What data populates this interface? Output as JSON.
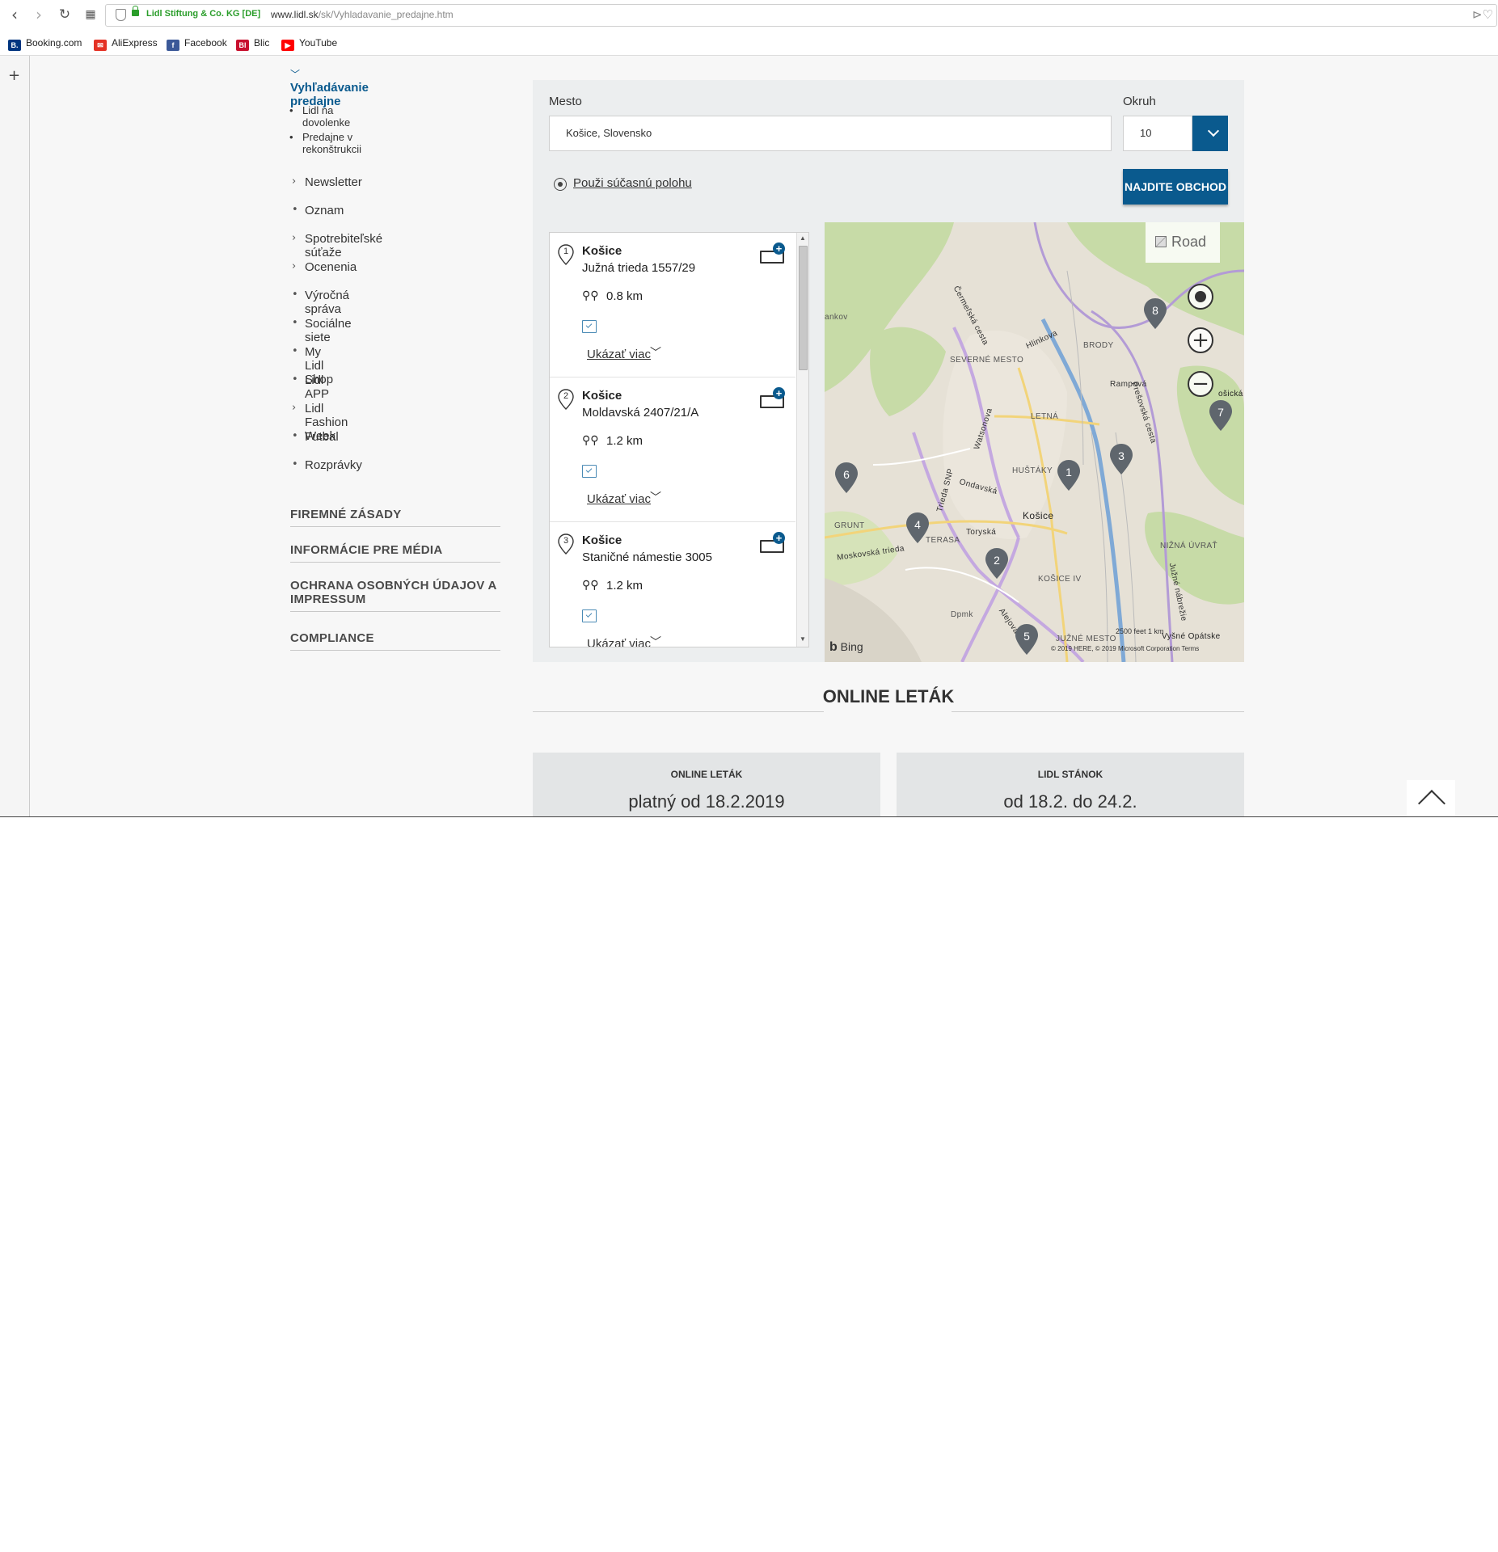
{
  "browser": {
    "org_label": "Lidl Stiftung & Co. KG [DE]",
    "url_domain": "www.lidl.sk",
    "url_path": "/sk/Vyhladavanie_predajne.htm",
    "bookmarks": [
      {
        "label": "Booking.com",
        "icon": "B.",
        "color": "#003580"
      },
      {
        "label": "AliExpress",
        "icon": "A",
        "color": "#e43225"
      },
      {
        "label": "Facebook",
        "icon": "f",
        "color": "#3b5998"
      },
      {
        "label": "Blic",
        "icon": "Bl",
        "color": "#c8102e"
      },
      {
        "label": "YouTube",
        "icon": "▶",
        "color": "#ff0000"
      }
    ]
  },
  "leftnav": {
    "active": "Vyhľadávanie predajne",
    "sub_items": [
      "Lidl na dovolenke",
      "Predajne v rekonštrukcii"
    ],
    "items": [
      {
        "label": "Newsletter",
        "mark": "〉"
      },
      {
        "label": "Oznam",
        "mark": "•"
      },
      {
        "label": "Spotrebiteľské súťaže",
        "mark": "〉"
      },
      {
        "label": "Ocenenia",
        "mark": "〉"
      },
      {
        "label": "Výročná správa",
        "mark": "•"
      },
      {
        "label": "Sociálne siete",
        "mark": "•"
      },
      {
        "label": "My Lidl Shop",
        "mark": "•"
      },
      {
        "label": "Lidl APP",
        "mark": "•"
      },
      {
        "label": "Lidl Fashion Week",
        "mark": "〉"
      },
      {
        "label": "Futbal",
        "mark": "•"
      },
      {
        "label": "Rozprávky",
        "mark": "•"
      }
    ],
    "sections": [
      "FIREMNÉ ZÁSADY",
      "INFORMÁCIE PRE MÉDIA",
      "OCHRANA OSOBNÝCH ÚDAJOV A IMPRESSUM",
      "COMPLIANCE"
    ]
  },
  "search": {
    "city_label": "Mesto",
    "city_value": "Košice, Slovensko",
    "radius_label": "Okruh",
    "radius_value": "10",
    "location_link": "Použi súčasnú polohu",
    "find_button": "NAJDITE OBCHOD"
  },
  "results": [
    {
      "num": "1",
      "city": "Košice",
      "address": "Južná trieda 1557/29",
      "distance": "0.8 km",
      "more": "Ukázať viac"
    },
    {
      "num": "2",
      "city": "Košice",
      "address": "Moldavská 2407/21/A",
      "distance": "1.2 km",
      "more": "Ukázať viac"
    },
    {
      "num": "3",
      "city": "Košice",
      "address": "Staničné námestie 3005",
      "distance": "1.2 km",
      "more": "Ukázať viac"
    }
  ],
  "map": {
    "view_toggle": "Road",
    "labels": [
      "ankov",
      "SEVERNÉ MESTO",
      "BRODY",
      "LETNÁ",
      "HUŠTÁKY",
      "Košice",
      "GRUNT",
      "TERASA",
      "NIŽNÁ ÚVRAŤ",
      "KOŠICE IV",
      "JUŽNÉ MESTO",
      "Dpmk",
      "Vyšné Opátske",
      "ošická",
      "Hlinkova",
      "Rampová",
      "Ondavská",
      "Toryská",
      "Moskovská trieda",
      "Čermeľská cesta",
      "Prešovská cesta",
      "Trieda SNP",
      "Watsonova",
      "Južné nábrežie",
      "Alejová"
    ],
    "pins": [
      "1",
      "2",
      "3",
      "4",
      "5",
      "6",
      "7",
      "8"
    ],
    "attribution": "Bing",
    "copyright": "© 2019 HERE, © 2019 Microsoft Corporation  Terms",
    "scale": "2500 feet      1 km"
  },
  "flyer": {
    "title": "ONLINE LETÁK",
    "cards": [
      {
        "heading": "ONLINE LETÁK",
        "text": "platný od 18.2.2019"
      },
      {
        "heading": "LIDL STÁNOK",
        "text": "od 18.2. do 24.2."
      }
    ]
  },
  "colors": {
    "accent": "#0a5a8e",
    "panel": "#eceeef",
    "pin": "#5f666d"
  }
}
